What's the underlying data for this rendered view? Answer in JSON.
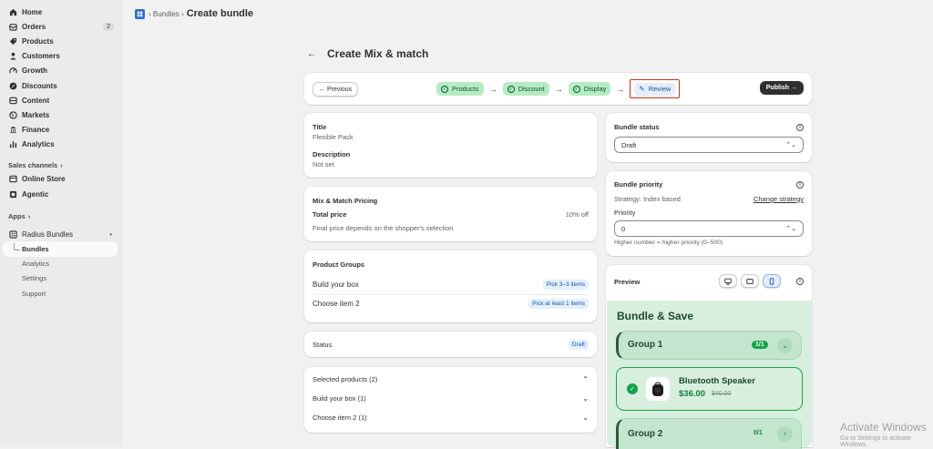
{
  "sidebar": {
    "items": [
      {
        "label": "Home",
        "icon": "home-icon"
      },
      {
        "label": "Orders",
        "icon": "orders-icon",
        "count": "2"
      },
      {
        "label": "Products",
        "icon": "tag-icon"
      },
      {
        "label": "Customers",
        "icon": "person-icon"
      },
      {
        "label": "Growth",
        "icon": "growth-icon"
      },
      {
        "label": "Discounts",
        "icon": "discount-icon"
      },
      {
        "label": "Content",
        "icon": "content-icon"
      },
      {
        "label": "Markets",
        "icon": "globe-icon"
      },
      {
        "label": "Finance",
        "icon": "bank-icon"
      },
      {
        "label": "Analytics",
        "icon": "chart-icon"
      }
    ],
    "sales_channels_label": "Sales channels",
    "sales_channels": [
      {
        "label": "Online Store",
        "icon": "store-icon"
      },
      {
        "label": "Agentic",
        "icon": "agentic-icon"
      }
    ],
    "apps_label": "Apps",
    "app_name": "Radius Bundles",
    "app_dots": "•",
    "app_subitems": [
      "Bundles",
      "Analytics",
      "Settings",
      "Support"
    ]
  },
  "breadcrumb": {
    "parent": "Bundles",
    "current": "Create bundle"
  },
  "page": {
    "title": "Create Mix & match"
  },
  "stepper": {
    "previous_label": "← Previous",
    "steps": [
      "Products",
      "Discount",
      "Display"
    ],
    "review_label": "Review",
    "publish_label": "Publish →"
  },
  "summary": {
    "title_label": "Title",
    "title_value": "Flexible Pack",
    "description_label": "Description",
    "description_value": "Not set"
  },
  "pricing": {
    "heading": "Mix & Match Pricing",
    "total_label": "Total price",
    "total_value": "10% off",
    "note": "Final price depends on the shopper's selection"
  },
  "product_groups": {
    "heading": "Product Groups",
    "groups": [
      {
        "name": "Build your box",
        "badge": "Pick 3–3 items"
      },
      {
        "name": "Choose item 2",
        "badge": "Pick at least 1 items"
      }
    ]
  },
  "status": {
    "label": "Status",
    "badge": "Draft"
  },
  "selected_products": {
    "heading": "Selected products (2)",
    "items": [
      "Build your box (1)",
      "Choose item 2 (1)"
    ]
  },
  "bundle_status": {
    "label": "Bundle status",
    "value": "Draft"
  },
  "bundle_priority": {
    "label": "Bundle priority",
    "strategy": "Strategy: Index based",
    "change_link": "Change strategy",
    "priority_label": "Priority",
    "priority_value": "0",
    "help": "Higher number = higher priority (0–500)"
  },
  "preview": {
    "label": "Preview",
    "widget_title": "Bundle & Save",
    "group1": {
      "name": "Group 1",
      "count": "1/1"
    },
    "product": {
      "name": "Bluetooth Speaker",
      "price": "$36.00",
      "compare_price": "$40.00"
    },
    "group2": {
      "name": "Group 2",
      "count": "0/1"
    }
  },
  "watermark": {
    "line1": "Activate Windows",
    "line2": "Go to Settings to activate Windows."
  },
  "colors": {
    "accent_green": "#16a34a",
    "step_green": "#b5ecc4",
    "review_red": "#d72c0d",
    "preview_bg": "#d8efdf"
  }
}
